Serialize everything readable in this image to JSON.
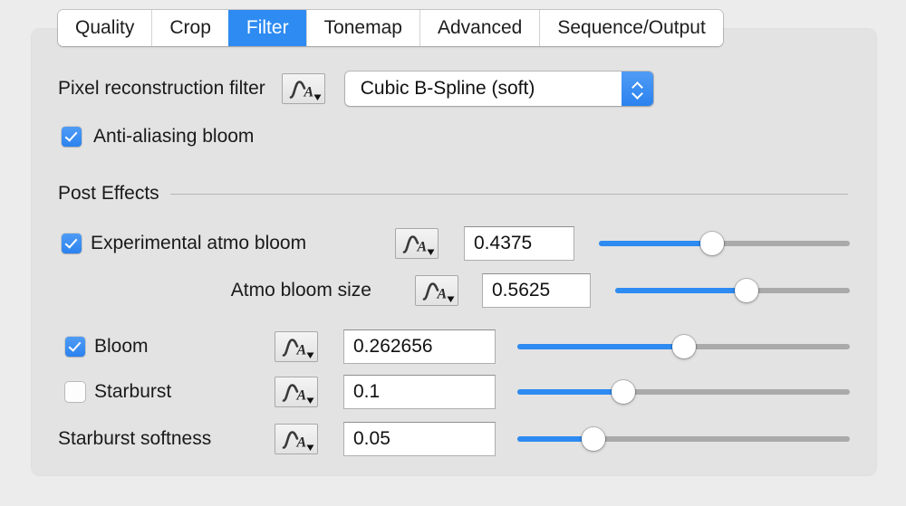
{
  "tabs": [
    {
      "label": "Quality",
      "selected": false
    },
    {
      "label": "Crop",
      "selected": false
    },
    {
      "label": "Filter",
      "selected": true
    },
    {
      "label": "Tonemap",
      "selected": false
    },
    {
      "label": "Advanced",
      "selected": false
    },
    {
      "label": "Sequence/Output",
      "selected": false
    }
  ],
  "colors": {
    "accent": "#2e8bf2",
    "panel_bg": "#e3e3e3",
    "window_bg": "#ececec",
    "track": "#aaaaaa",
    "text": "#1a1a1a"
  },
  "pixel_filter": {
    "label": "Pixel reconstruction filter",
    "curve_icon": "animation-curve-icon",
    "value": "Cubic B-Spline (soft)",
    "options": [
      "Cubic B-Spline (soft)"
    ]
  },
  "antialiasing": {
    "label": "Anti-aliasing bloom",
    "checked": true
  },
  "post_effects": {
    "title": "Post Effects",
    "rows": [
      {
        "label": "Experimental atmo bloom",
        "has_checkbox": true,
        "checked": true,
        "curve_icon": "animation-curve-icon",
        "value": "0.4375",
        "slider_percent": 45
      },
      {
        "label": "Atmo bloom size",
        "has_checkbox": false,
        "checked": false,
        "curve_icon": "animation-curve-icon",
        "value": "0.5625",
        "slider_percent": 56
      },
      {
        "label": "Bloom",
        "has_checkbox": true,
        "checked": true,
        "curve_icon": "animation-curve-icon",
        "value": "0.262656",
        "slider_percent": 50
      },
      {
        "label": "Starburst",
        "has_checkbox": true,
        "checked": false,
        "curve_icon": "animation-curve-icon",
        "value": "0.1",
        "slider_percent": 32
      },
      {
        "label": "Starburst softness",
        "has_checkbox": false,
        "checked": false,
        "curve_icon": "animation-curve-icon",
        "value": "0.05",
        "slider_percent": 23
      }
    ]
  }
}
